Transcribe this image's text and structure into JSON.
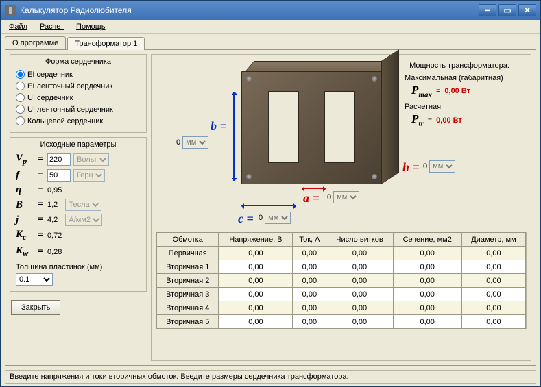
{
  "window": {
    "title": "Калькулятор Радиолюбителя"
  },
  "menu": {
    "file": "Файл",
    "calc": "Расчет",
    "help": "Помощь"
  },
  "tabs": {
    "about": "О программе",
    "tr1": "Трансформатор 1"
  },
  "core_shape": {
    "legend": "Форма сердечника",
    "opts": [
      "EI сердечник",
      "EI ленточный сердечник",
      "UI сердечник",
      "UI ленточный сердечник",
      "Кольцевой сердечник"
    ]
  },
  "params": {
    "legend": "Исходные параметры",
    "vp": {
      "sym": "V",
      "sub": "p",
      "val": "220",
      "unit": "Вольт"
    },
    "f": {
      "sym": "f",
      "val": "50",
      "unit": "Герц"
    },
    "eta": {
      "sym": "η",
      "val": "0,95"
    },
    "b": {
      "sym": "B",
      "val": "1,2",
      "unit": "Тесла"
    },
    "j": {
      "sym": "j",
      "val": "4,2",
      "unit": "А/мм2"
    },
    "kc": {
      "sym": "K",
      "sub": "c",
      "val": "0,72"
    },
    "kw": {
      "sym": "K",
      "sub": "w",
      "val": "0,28"
    },
    "thickness_label": "Толщина пластинок (мм)",
    "thickness_val": "0.1"
  },
  "buttons": {
    "close": "Закрыть"
  },
  "dims": {
    "b": {
      "label": "b =",
      "val": "0",
      "unit": "мм"
    },
    "c": {
      "label": "c =",
      "val": "0",
      "unit": "мм"
    },
    "a": {
      "label": "a =",
      "val": "0",
      "unit": "мм"
    },
    "h": {
      "label": "h =",
      "val": "0",
      "unit": "мм"
    }
  },
  "power": {
    "title": "Мощность трансформатора:",
    "max_label": "Максимальная (габаритная)",
    "pmax_sym": "P",
    "pmax_sub": "max",
    "pmax_val": "0,00 Вт",
    "calc_label": "Расчетная",
    "ptr_sym": "P",
    "ptr_sub": "tr",
    "ptr_val": "0,00 Вт",
    "eq": "="
  },
  "table": {
    "headers": [
      "Обмотка",
      "Напряжение, В",
      "Ток, А",
      "Число витков",
      "Сечение, мм2",
      "Диаметр, мм"
    ],
    "rows": [
      {
        "name": "Первичная",
        "v": [
          "0,00",
          "0,00",
          "0,00",
          "0,00",
          "0,00"
        ]
      },
      {
        "name": "Вторичная 1",
        "v": [
          "0,00",
          "0,00",
          "0,00",
          "0,00",
          "0,00"
        ]
      },
      {
        "name": "Вторичная 2",
        "v": [
          "0,00",
          "0,00",
          "0,00",
          "0,00",
          "0,00"
        ]
      },
      {
        "name": "Вторичная 3",
        "v": [
          "0,00",
          "0,00",
          "0,00",
          "0,00",
          "0,00"
        ]
      },
      {
        "name": "Вторичная 4",
        "v": [
          "0,00",
          "0,00",
          "0,00",
          "0,00",
          "0,00"
        ]
      },
      {
        "name": "Вторичная 5",
        "v": [
          "0,00",
          "0,00",
          "0,00",
          "0,00",
          "0,00"
        ]
      }
    ]
  },
  "status": "Введите напряжения и токи вторичных обмоток. Введите размеры сердечника трансформатора."
}
